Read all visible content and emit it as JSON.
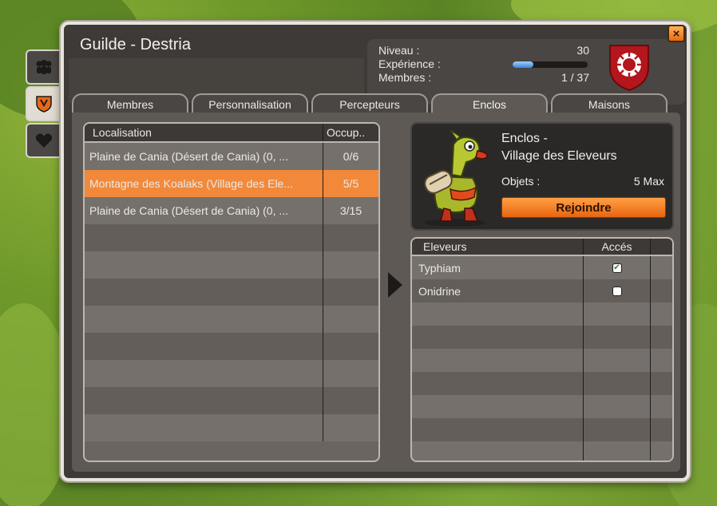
{
  "window": {
    "title": "Guilde - Destria",
    "close_label": "×"
  },
  "guild_info": {
    "level_label": "Niveau :",
    "level_value": "30",
    "xp_label": "Expérience :",
    "xp_progress": 0.28,
    "members_label": "Membres :",
    "members_value": "1 / 37"
  },
  "side_tabs": [
    {
      "icon": "members-icon",
      "active": false
    },
    {
      "icon": "guild-shield-icon",
      "active": true
    },
    {
      "icon": "heart-icon",
      "active": false
    }
  ],
  "tabs": [
    {
      "label": "Membres",
      "active": false
    },
    {
      "label": "Personnalisation",
      "active": false
    },
    {
      "label": "Percepteurs",
      "active": false
    },
    {
      "label": "Enclos",
      "active": true
    },
    {
      "label": "Maisons",
      "active": false
    }
  ],
  "paddocks_table": {
    "headers": [
      "Localisation",
      "Occup.."
    ],
    "rows": [
      {
        "location": "Plaine de Cania (Désert de Cania) (0, ...",
        "occupation": "0/6",
        "selected": false
      },
      {
        "location": "Montagne des Koalaks (Village des Ele...",
        "occupation": "5/5",
        "selected": true
      },
      {
        "location": "Plaine de Cania (Désert de Cania) (0, ...",
        "occupation": "3/15",
        "selected": false
      }
    ],
    "empty_rows": 8
  },
  "enclos_detail": {
    "title_line1": "Enclos -",
    "title_line2": "Village des Eleveurs",
    "objects_label": "Objets :",
    "objects_value": "5 Max",
    "join_button": "Rejoindre"
  },
  "breeders_table": {
    "headers": [
      "Eleveurs",
      "Accés"
    ],
    "rows": [
      {
        "name": "Typhiam",
        "access": true
      },
      {
        "name": "Onidrine",
        "access": false
      }
    ],
    "empty_rows": 7
  },
  "colors": {
    "selected_row": "#f2893a",
    "button_orange": "#e8650f",
    "panel_dark": "#3d3a38"
  }
}
